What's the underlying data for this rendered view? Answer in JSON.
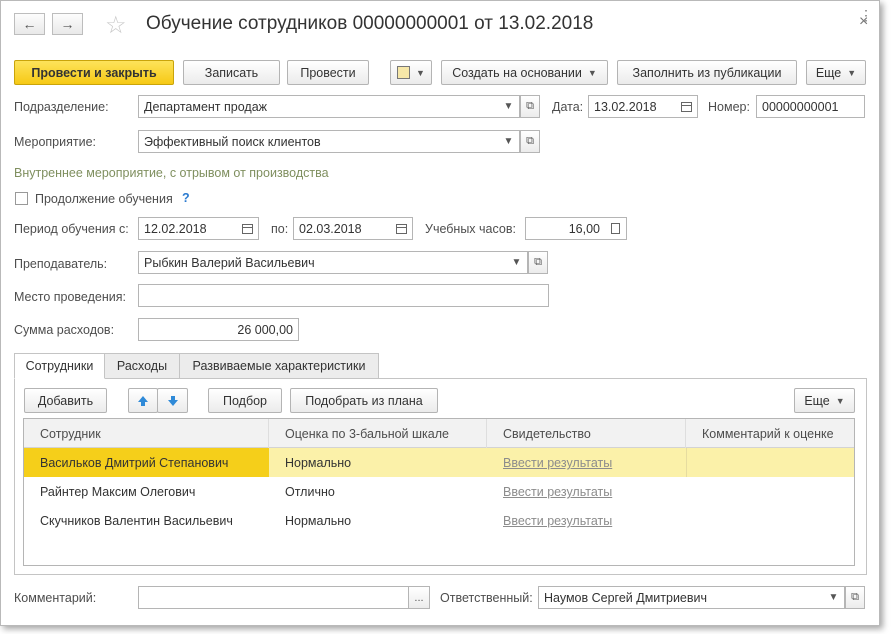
{
  "window": {
    "title": "Обучение сотрудников 00000000001 от 13.02.2018",
    "back_icon": "←",
    "forward_icon": "→",
    "star_icon": "☆",
    "menu_icon": "⋮",
    "close_icon": "×"
  },
  "toolbar": {
    "post_close": "Провести и закрыть",
    "save": "Записать",
    "post": "Провести",
    "create_based": "Создать на основании",
    "fill_from_pub": "Заполнить из публикации",
    "more": "Еще"
  },
  "form": {
    "department_label": "Подразделение:",
    "department_value": "Департамент продаж",
    "date_label": "Дата:",
    "date_value": "13.02.2018",
    "number_label": "Номер:",
    "number_value": "00000000001",
    "event_label": "Мероприятие:",
    "event_value": "Эффективный поиск клиентов",
    "event_info": "Внутреннее мероприятие, с отрывом от производства",
    "continuation_label": "Продолжение обучения",
    "continuation_help": "?",
    "period_label": "Период обучения с:",
    "period_from": "12.02.2018",
    "period_to_label": "по:",
    "period_to": "02.03.2018",
    "hours_label": "Учебных часов:",
    "hours_value": "16,00",
    "teacher_label": "Преподаватель:",
    "teacher_value": "Рыбкин Валерий Васильевич",
    "place_label": "Место проведения:",
    "place_value": "",
    "cost_label": "Сумма расходов:",
    "cost_value": "26 000,00",
    "comment_label": "Комментарий:",
    "comment_value": "",
    "comment_btn": "...",
    "responsible_label": "Ответственный:",
    "responsible_value": "Наумов Сергей Дмитриевич"
  },
  "tabs": [
    "Сотрудники",
    "Расходы",
    "Развиваемые характеристики"
  ],
  "grid_toolbar": {
    "add": "Добавить",
    "up_icon": "arrow-up",
    "down_icon": "arrow-down",
    "pick": "Подбор",
    "pick_plan": "Подобрать из плана",
    "more": "Еще"
  },
  "table": {
    "headers": [
      "Сотрудник",
      "Оценка по 3-бальной шкале",
      "Свидетельство",
      "Комментарий к оценке"
    ],
    "rows": [
      {
        "name": "Васильков Дмитрий Степанович",
        "score": "Нормально",
        "cert": "Ввести результаты",
        "comment": ""
      },
      {
        "name": "Райнтер Максим Олегович",
        "score": "Отлично",
        "cert": "Ввести результаты",
        "comment": ""
      },
      {
        "name": "Скучников Валентин Васильевич",
        "score": "Нормально",
        "cert": "Ввести результаты",
        "comment": ""
      }
    ]
  },
  "colors": {
    "primary_button": "#f6c915",
    "selected_row": "#fbf1a9",
    "selected_cell": "#f5cf1a",
    "info_text": "#7f8f5f",
    "help_icon": "#2b7bd0"
  }
}
